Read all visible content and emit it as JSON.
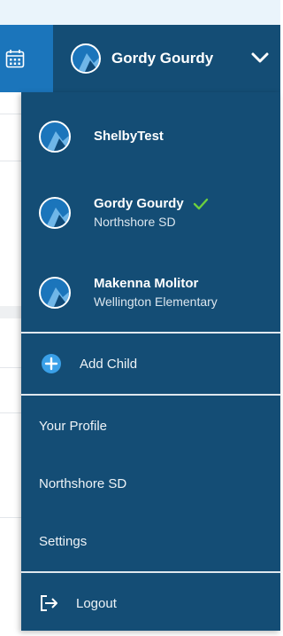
{
  "header": {
    "calendar_icon": "calendar-icon",
    "user_name": "Gordy Gourdy",
    "dropdown_icon": "chevron-down-icon"
  },
  "menu": {
    "accounts": [
      {
        "name": "ShelbyTest",
        "subtitle": "",
        "selected": false
      },
      {
        "name": "Gordy Gourdy",
        "subtitle": "Northshore SD",
        "selected": true
      },
      {
        "name": "Makenna Molitor",
        "subtitle": "Wellington Elementary",
        "selected": false
      }
    ],
    "add_child": "Add Child",
    "links": [
      "Your Profile",
      "Northshore SD",
      "Settings"
    ],
    "logout": "Logout"
  },
  "colors": {
    "menu_bg": "#144d75",
    "calendar_bg": "#1b75bb",
    "check": "#6ccf3e",
    "add_icon": "#3aa0e8"
  }
}
